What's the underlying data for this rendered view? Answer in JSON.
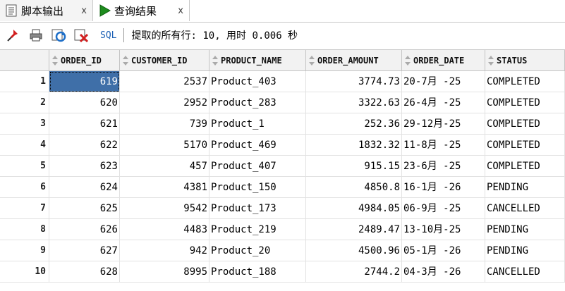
{
  "tabs": [
    {
      "label": "脚本输出",
      "close": "x",
      "icon": "script-doc-icon"
    },
    {
      "label": "查询结果",
      "close": "x",
      "icon": "play-icon"
    }
  ],
  "toolbar": {
    "icons": [
      "pin-icon",
      "print-icon",
      "refresh-icon",
      "delete-icon"
    ],
    "sql_label": "SQL",
    "separator": "|",
    "status": "提取的所有行: 10, 用时 0.006 秒"
  },
  "colors": {
    "selection": "#3f6fa8",
    "header_bg": "#f2f2f2",
    "play_green": "#1e8c1e"
  },
  "table": {
    "columns": [
      "ORDER_ID",
      "CUSTOMER_ID",
      "PRODUCT_NAME",
      "ORDER_AMOUNT",
      "ORDER_DATE",
      "STATUS"
    ],
    "rows": [
      {
        "n": "1",
        "cells": [
          "619",
          "2537",
          "Product_403",
          "3774.73",
          "20-7月 -25",
          "COMPLETED"
        ]
      },
      {
        "n": "2",
        "cells": [
          "620",
          "2952",
          "Product_283",
          "3322.63",
          "26-4月 -25",
          "COMPLETED"
        ]
      },
      {
        "n": "3",
        "cells": [
          "621",
          "739",
          "Product_1",
          "252.36",
          "29-12月-25",
          "COMPLETED"
        ]
      },
      {
        "n": "4",
        "cells": [
          "622",
          "5170",
          "Product_469",
          "1832.32",
          "11-8月 -25",
          "COMPLETED"
        ]
      },
      {
        "n": "5",
        "cells": [
          "623",
          "457",
          "Product_407",
          "915.15",
          "23-6月 -25",
          "COMPLETED"
        ]
      },
      {
        "n": "6",
        "cells": [
          "624",
          "4381",
          "Product_150",
          "4850.8",
          "16-1月 -26",
          "PENDING"
        ]
      },
      {
        "n": "7",
        "cells": [
          "625",
          "9542",
          "Product_173",
          "4984.05",
          "06-9月 -25",
          "CANCELLED"
        ]
      },
      {
        "n": "8",
        "cells": [
          "626",
          "4483",
          "Product_219",
          "2489.47",
          "13-10月-25",
          "PENDING"
        ]
      },
      {
        "n": "9",
        "cells": [
          "627",
          "942",
          "Product_20",
          "4500.96",
          "05-1月 -26",
          "PENDING"
        ]
      },
      {
        "n": "10",
        "cells": [
          "628",
          "8995",
          "Product_188",
          "2744.2",
          "04-3月 -26",
          "CANCELLED"
        ]
      }
    ]
  }
}
